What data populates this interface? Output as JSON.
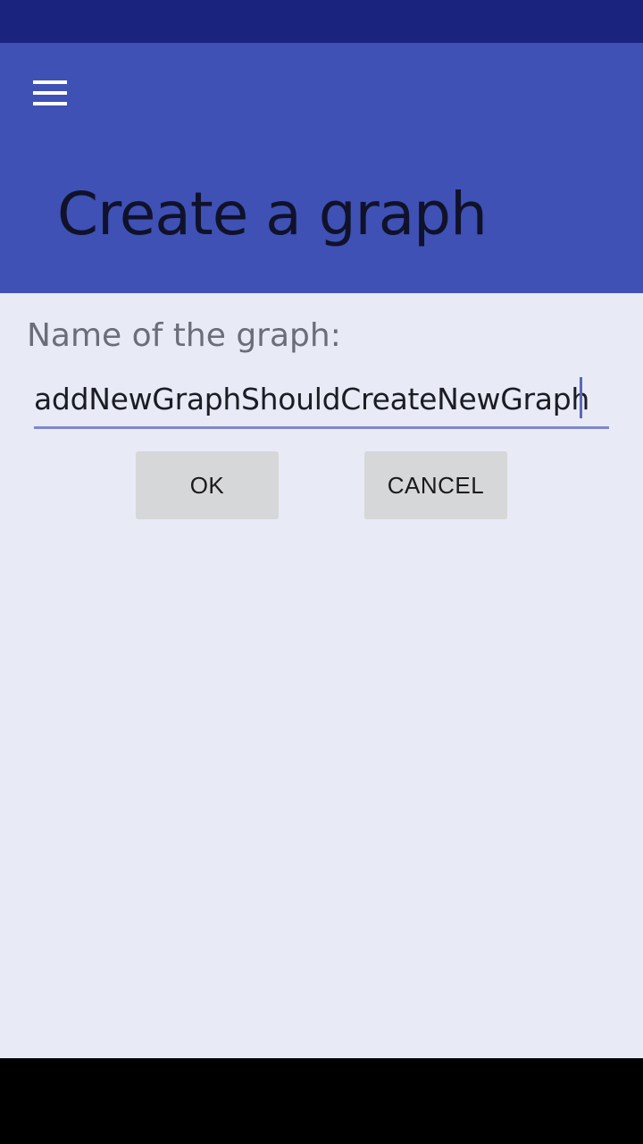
{
  "colors": {
    "status_bar": "#1a237e",
    "app_bar": "#3f51b5",
    "content_bg": "#e8eaf6",
    "nav_bar": "#000000",
    "input_underline": "#7f88c9",
    "button_bg": "#d6d7d8"
  },
  "app_bar": {
    "menu_icon": "hamburger-menu-icon",
    "title": "Create a graph"
  },
  "form": {
    "label": "Name of the graph:",
    "input_value": "addNewGraphShouldCreateNewGraph",
    "ok_label": "OK",
    "cancel_label": "CANCEL"
  }
}
